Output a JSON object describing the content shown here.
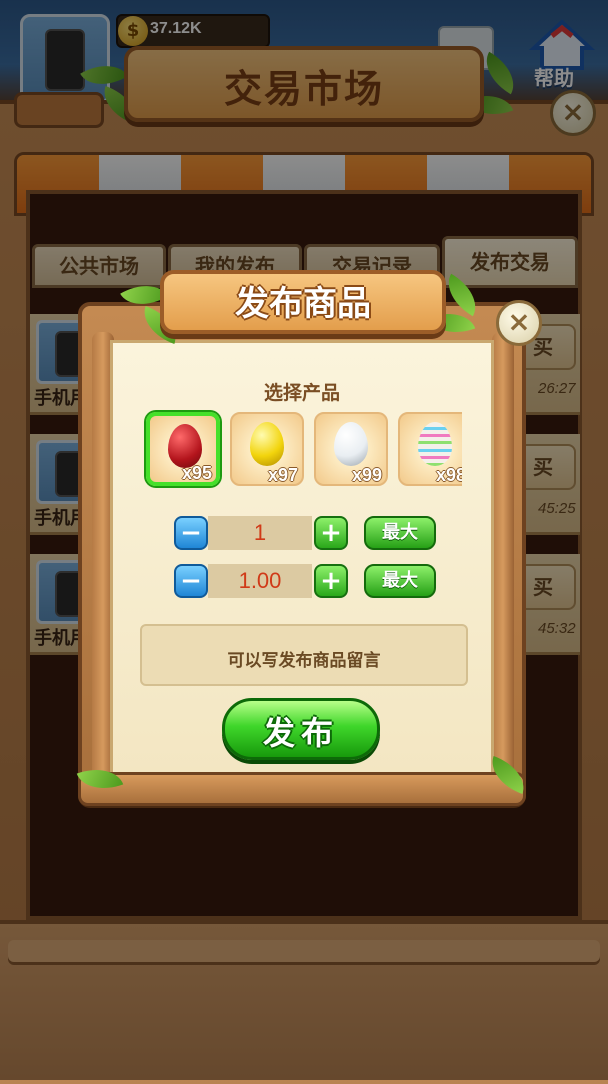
{
  "hud": {
    "coin_icon": "$",
    "coins": "37.12K",
    "help_label": "帮助",
    "icons": [
      "player-avatar-icon",
      "coin-icon",
      "mail-icon",
      "help-icon"
    ]
  },
  "market": {
    "title": "交易市场",
    "close": "×",
    "tabs": [
      "公共市场",
      "我的发布",
      "交易记录",
      "发布交易"
    ],
    "active_tab": "发布交易",
    "rows": [
      {
        "name": "手机用",
        "buy": "买",
        "time": "26:27"
      },
      {
        "name": "手机用",
        "buy": "买",
        "time": "45:25"
      },
      {
        "name": "手机用",
        "buy": "买",
        "time": "45:32"
      }
    ]
  },
  "modal": {
    "title": "发布商品",
    "close": "×",
    "select_label": "选择产品",
    "products": [
      {
        "name": "red-egg",
        "count": "x95",
        "color": "#b3141c",
        "selected": true
      },
      {
        "name": "gold-egg",
        "count": "x97",
        "color": "#f2d40c",
        "selected": false
      },
      {
        "name": "silver-egg",
        "count": "x99",
        "color": "#e9eef2",
        "selected": false
      },
      {
        "name": "rainbow-egg",
        "count": "x98",
        "color": "#f4f0ea",
        "selected": false
      }
    ],
    "quantity": {
      "minus": "−",
      "value": "1",
      "plus": "+",
      "max": "最大"
    },
    "price": {
      "minus": "−",
      "value": "1.00",
      "plus": "+",
      "max": "最大"
    },
    "message_placeholder": "可以写发布商品留言",
    "publish": "发布"
  },
  "colors": {
    "wood": "#b57a45",
    "paper": "#fbf4dc",
    "accent_green": "#3fd62a",
    "accent_blue": "#1f86d6",
    "selection": "#45e02a"
  }
}
